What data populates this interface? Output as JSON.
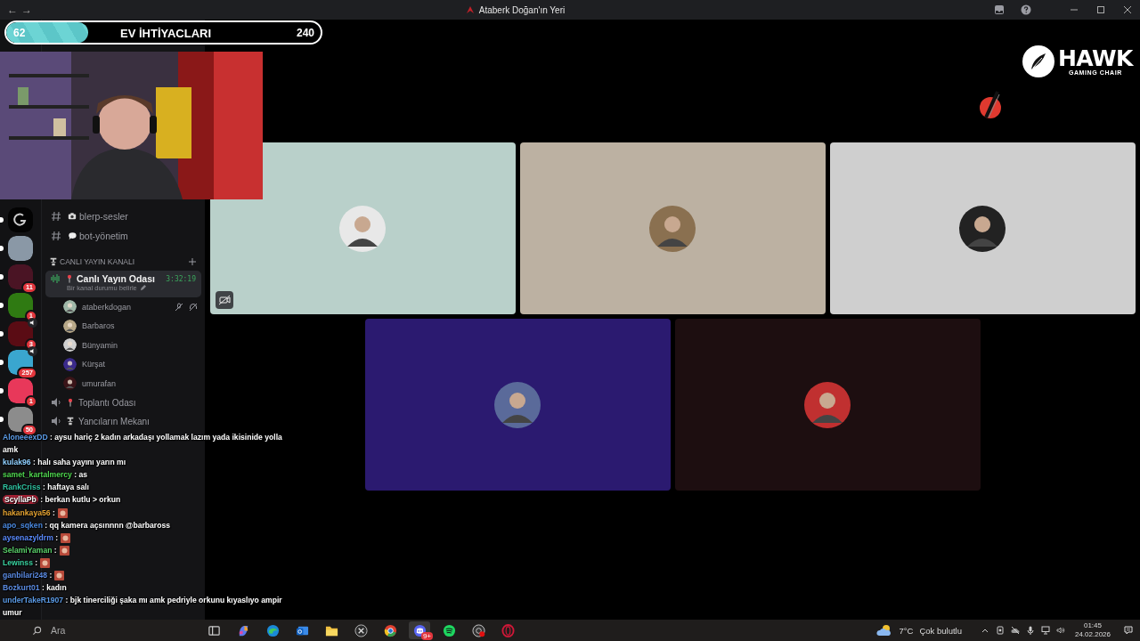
{
  "window": {
    "title": "Ataberk Doğan'ın Yeri",
    "back": "←",
    "forward": "→"
  },
  "goal": {
    "current": "62",
    "title": "EV İHTİYACLARI",
    "target": "240",
    "level": 0.26
  },
  "servers": [
    {
      "color": "#030303",
      "speaking": false,
      "unread": true
    },
    {
      "color": "#8a98a6",
      "speaking": false,
      "unread": true
    },
    {
      "color": "#4a1424",
      "badge": "11",
      "speaking": false,
      "unread": true
    },
    {
      "color": "#2f7a12",
      "badge": "1",
      "speaking": false,
      "unread": true
    },
    {
      "color": "#5a0c14",
      "badge": "3",
      "speaking": true,
      "unread": true
    },
    {
      "color": "#3aa6cf",
      "badge": "257",
      "speaking": true,
      "unread": true
    },
    {
      "color": "#e8385a",
      "badge": "1",
      "speaking": false,
      "unread": true
    },
    {
      "color": "#8c8c8c",
      "badge": "50",
      "speaking": false,
      "unread": true
    }
  ],
  "channels": [
    {
      "kind": "text",
      "name": "blerp-sesler"
    },
    {
      "kind": "text",
      "name": "bot-yönetim"
    },
    {
      "kind": "category",
      "name": "CANLI YAYIN KANALI"
    },
    {
      "kind": "voice",
      "name": "Canlı Yayın Odası",
      "selected": true,
      "time": "3:32:19",
      "status": "Bir kanal durumu belirle",
      "members": [
        {
          "name": "ataberkdogan",
          "color": "#9fb8a8",
          "muted": true
        },
        {
          "name": "Barbaros",
          "color": "#b8a888",
          "muted": false
        },
        {
          "name": "Bünyamin",
          "color": "#d0d0d0",
          "muted": false
        },
        {
          "name": "Kürşat",
          "color": "#3a2a8a",
          "muted": false
        },
        {
          "name": "umurafan",
          "color": "#3a1418",
          "muted": false
        }
      ]
    },
    {
      "kind": "voice",
      "name": "Toplantı Odası",
      "selected": false
    },
    {
      "kind": "voice",
      "name": "Yancıların Mekanı",
      "selected": false
    }
  ],
  "tiles": [
    {
      "color": "#b9d0ca",
      "status_icon": true
    },
    {
      "color": "#bcb1a2",
      "status_icon": false
    },
    {
      "color": "#cfcfcf",
      "status_icon": false
    },
    {
      "color": "#2b1a70",
      "status_icon": false
    },
    {
      "color": "#1d0e10",
      "status_icon": false
    }
  ],
  "chat": [
    {
      "user": "AloneeexDD",
      "color": "#5b9be6",
      "text": ": aysu hariç 2 kadın arkadaşı yollamak lazım yada ikisinide yolla amk",
      "emote": false,
      "highlight": false
    },
    {
      "user": "kulak96",
      "color": "#8fcfff",
      "text": ": halı saha yayını yarın mı",
      "emote": false,
      "highlight": false
    },
    {
      "user": "samet_kartalmercy",
      "color": "#4fd64f",
      "text": ": as",
      "emote": false,
      "highlight": false
    },
    {
      "user": "RankCriss",
      "color": "#2fc2a0",
      "text": ": haftaya salı",
      "emote": false,
      "highlight": false
    },
    {
      "user": "ScyllaPb",
      "text": ": berkan kutlu > orkun",
      "emote": false,
      "highlight": true
    },
    {
      "user": "hakankaya56",
      "color": "#e3a232",
      "text": ":",
      "emote": true,
      "highlight": false
    },
    {
      "user": "apo_sqken",
      "color": "#4b8ae2",
      "text": ": qq kamera açsınnnn @barbaross",
      "emote": false,
      "highlight": false
    },
    {
      "user": "aysenazyldrm",
      "color": "#5b8bff",
      "text": ":",
      "emote": true,
      "highlight": false
    },
    {
      "user": "SelamiYaman",
      "color": "#5ad26a",
      "text": ":",
      "emote": true,
      "highlight": false
    },
    {
      "user": "Lewinss",
      "color": "#3ad2a0",
      "text": ":",
      "emote": true,
      "highlight": false
    },
    {
      "user": "ganbilari248",
      "color": "#5b8be3",
      "text": ":",
      "emote": true,
      "highlight": false
    },
    {
      "user": "Bozkurt01",
      "color": "#5b8be1",
      "text": ": kadın",
      "emote": false,
      "highlight": false
    },
    {
      "user": "underTakeR1907",
      "color": "#5b9be7",
      "text": ": bjk tinerciliği şaka mı amk pedriyle orkunu kıyaslıyo ampir umur",
      "emote": false,
      "highlight": false
    }
  ],
  "sponsor": {
    "name": "HAWK",
    "tagline": "GAMING CHAIR"
  },
  "taskbar": {
    "search": "Ara",
    "apps": [
      {
        "kind": "widgets",
        "selected": false
      },
      {
        "kind": "copilot",
        "selected": false
      },
      {
        "kind": "edge",
        "selected": false
      },
      {
        "kind": "outlook",
        "selected": false
      },
      {
        "kind": "folder",
        "selected": false
      },
      {
        "kind": "xbox",
        "selected": false
      },
      {
        "kind": "chrome",
        "selected": false
      },
      {
        "kind": "discord",
        "badge": "9+",
        "selected": true
      },
      {
        "kind": "spotify",
        "selected": false
      },
      {
        "kind": "obs",
        "selected": false
      },
      {
        "kind": "opera",
        "selected": false
      }
    ],
    "weather": "7°C",
    "weather_text": "Çok bulutlu",
    "time": "01:45",
    "date": "24.02.2026"
  }
}
